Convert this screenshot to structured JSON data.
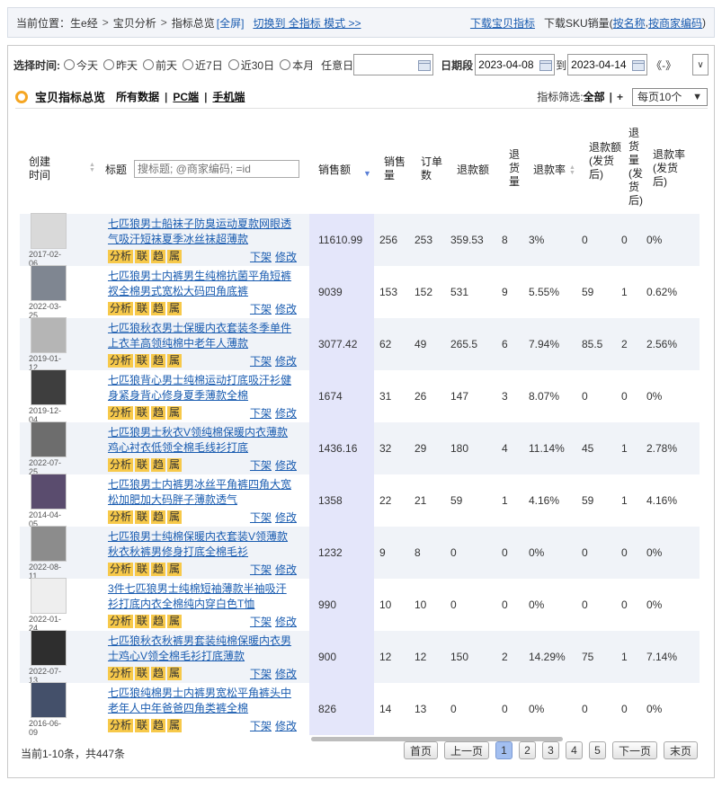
{
  "breadcrumb": {
    "prefix": "当前位置：",
    "items": [
      "生e经",
      "宝贝分析",
      "指标总览"
    ],
    "fullscreen": "[全屏]",
    "switch_link": "切换到 全指标 模式 >>",
    "download_link": "下载宝贝指标",
    "sku_prefix": "下载SKU销量(",
    "sku_by_name": "按名称",
    "sku_by_code": "按商家编码",
    "sku_suffix": ")"
  },
  "filter": {
    "label": "选择时间:",
    "options": [
      "今天",
      "昨天",
      "前天",
      "近7日",
      "近30日",
      "本月"
    ],
    "any_day": "任意日",
    "any_day_value": "",
    "range_label": "日期段",
    "start_date": "2023-04-08",
    "to": "到",
    "end_date": "2023-04-14",
    "nav": "《-》"
  },
  "section": {
    "title": "宝贝指标总览",
    "tabs": [
      "所有数据",
      "PC端",
      "手机端"
    ],
    "filter_label": "指标筛选:",
    "filter_value": "全部",
    "add": "+",
    "per_page": "每页10个"
  },
  "headers": {
    "created": "创建时间",
    "title": "标题",
    "search_placeholder": "搜标题; @商家编码; =id",
    "sales": "销售额",
    "qty": "销售量",
    "orders": "订单数",
    "refund_amt": "退款额",
    "return_qty": "退货量",
    "refund_rate": "退款率",
    "refund_amt_shipped": "退款额(发货后)",
    "return_qty_shipped": "退货量(发货后)",
    "refund_rate_shipped": "退款率(发货后)"
  },
  "row_actions": {
    "analyze": "分析",
    "link": "联",
    "trend": "趋",
    "attr": "属",
    "offshelf": "下架",
    "edit": "修改"
  },
  "rows": [
    {
      "date": "2017-02-06",
      "title": "七匹狼男士船袜子防臭运动夏款网眼透气吸汗短袜夏季冰丝袜超薄款",
      "sales": "11610.99",
      "qty": "256",
      "orders": "253",
      "refund": "359.53",
      "ret": "8",
      "rate": "3%",
      "refund2": "0",
      "ret2": "0",
      "rate2": "0%",
      "color": "#d9d9d9"
    },
    {
      "date": "2022-03-25",
      "title": "七匹狼男士内裤男生纯棉抗菌平角短裤衩全棉男式宽松大码四角底裤",
      "sales": "9039",
      "qty": "153",
      "orders": "152",
      "refund": "531",
      "ret": "9",
      "rate": "5.55%",
      "refund2": "59",
      "ret2": "1",
      "rate2": "0.62%",
      "color": "#7f8691"
    },
    {
      "date": "2019-01-12",
      "title": "七匹狼秋衣男士保暖内衣套装冬季单件上衣羊高领纯棉中老年人薄款",
      "sales": "3077.42",
      "qty": "62",
      "orders": "49",
      "refund": "265.5",
      "ret": "6",
      "rate": "7.94%",
      "refund2": "85.5",
      "ret2": "2",
      "rate2": "2.56%",
      "color": "#b5b5b5"
    },
    {
      "date": "2019-12-04",
      "title": "七匹狼背心男士纯棉运动打底吸汗衫健身紧身背心修身夏季薄款全棉",
      "sales": "1674",
      "qty": "31",
      "orders": "26",
      "refund": "147",
      "ret": "3",
      "rate": "8.07%",
      "refund2": "0",
      "ret2": "0",
      "rate2": "0%",
      "color": "#3e3e3e"
    },
    {
      "date": "2022-07-25",
      "title": "七匹狼男士秋衣V领纯棉保暖内衣薄款鸡心衬衣低领全棉毛线衫打底",
      "sales": "1436.16",
      "qty": "32",
      "orders": "29",
      "refund": "180",
      "ret": "4",
      "rate": "11.14%",
      "refund2": "45",
      "ret2": "1",
      "rate2": "2.78%",
      "color": "#6d6d6d"
    },
    {
      "date": "2014-04-05",
      "title": "七匹狼男士内裤男冰丝平角裤四角大宽松加肥加大码胖子薄款透气",
      "sales": "1358",
      "qty": "22",
      "orders": "21",
      "refund": "59",
      "ret": "1",
      "rate": "4.16%",
      "refund2": "59",
      "ret2": "1",
      "rate2": "4.16%",
      "color": "#5a4c6e"
    },
    {
      "date": "2022-08-11",
      "title": "七匹狼男士纯棉保暖内衣套装V领薄款秋衣秋裤男修身打底全棉毛衫",
      "sales": "1232",
      "qty": "9",
      "orders": "8",
      "refund": "0",
      "ret": "0",
      "rate": "0%",
      "refund2": "0",
      "ret2": "0",
      "rate2": "0%",
      "color": "#8c8c8c"
    },
    {
      "date": "2022-01-24",
      "title": "3件七匹狼男士纯棉短袖薄款半袖吸汗衫打底内衣全棉纯内穿白色T恤",
      "sales": "990",
      "qty": "10",
      "orders": "10",
      "refund": "0",
      "ret": "0",
      "rate": "0%",
      "refund2": "0",
      "ret2": "0",
      "rate2": "0%",
      "color": "#eeeeee"
    },
    {
      "date": "2022-07-13",
      "title": "七匹狼秋衣秋裤男套装纯棉保暖内衣男士鸡心V领全棉毛衫打底薄款",
      "sales": "900",
      "qty": "12",
      "orders": "12",
      "refund": "150",
      "ret": "2",
      "rate": "14.29%",
      "refund2": "75",
      "ret2": "1",
      "rate2": "7.14%",
      "color": "#2e2e2e"
    },
    {
      "date": "2016-06-09",
      "title": "七匹狼纯棉男士内裤男宽松平角裤头中老年人中年爸爸四角类裤全棉",
      "sales": "826",
      "qty": "14",
      "orders": "13",
      "refund": "0",
      "ret": "0",
      "rate": "0%",
      "refund2": "0",
      "ret2": "0",
      "rate2": "0%",
      "color": "#44506a"
    }
  ],
  "footer": {
    "summary": "当前1-10条，共447条",
    "first": "首页",
    "prev": "上一页",
    "pages": [
      "1",
      "2",
      "3",
      "4",
      "5"
    ],
    "current_page": "1",
    "next": "下一页",
    "last": "末页"
  }
}
